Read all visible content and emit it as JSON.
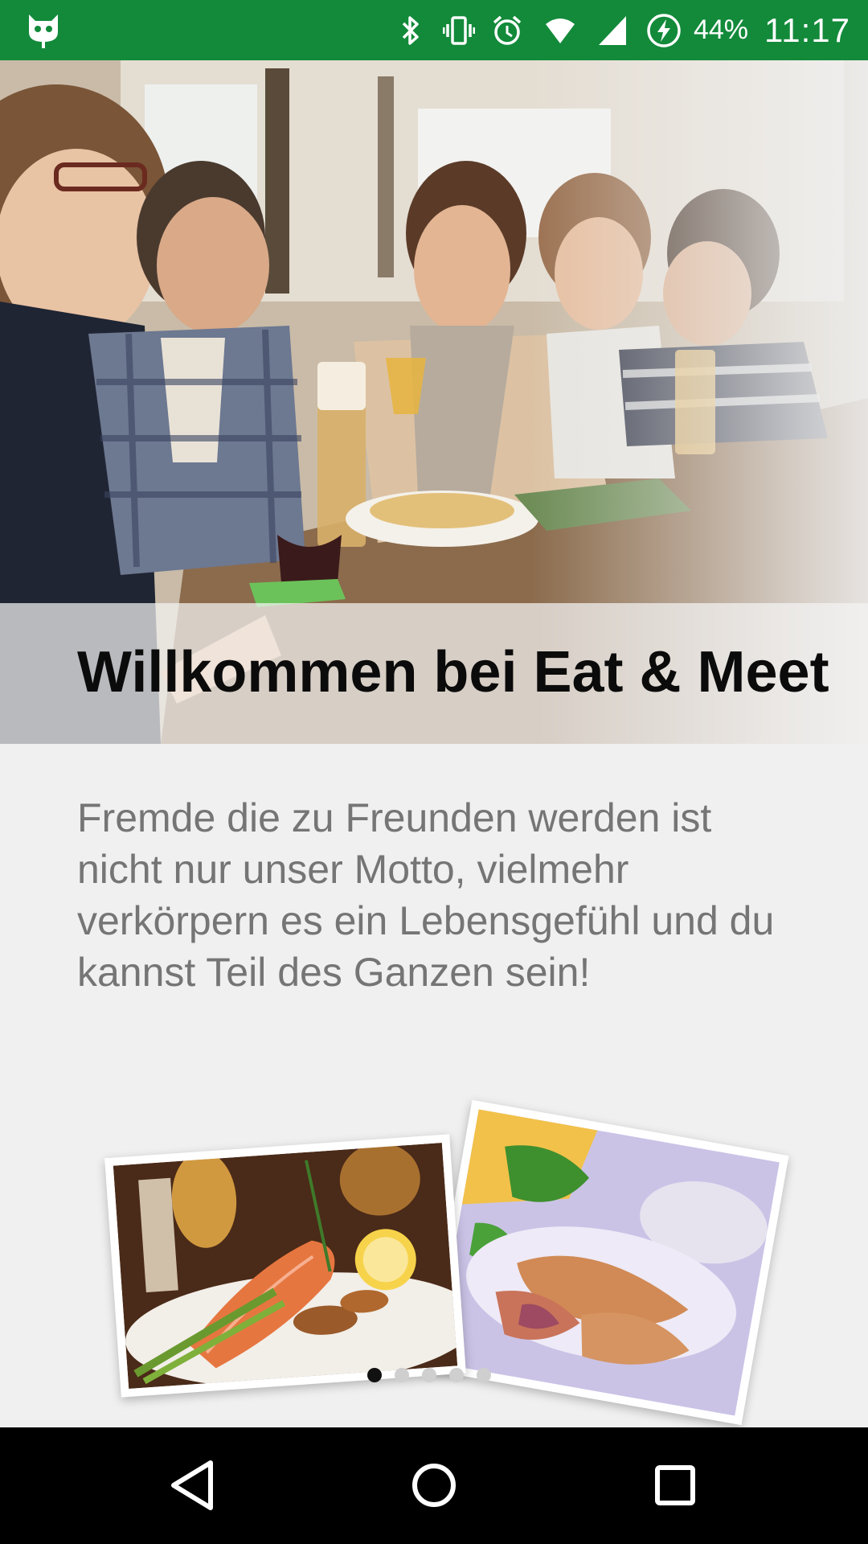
{
  "status_bar": {
    "left_icon": "cyanogen-mascot-icon",
    "icons": [
      "bluetooth-icon",
      "vibrate-icon",
      "alarm-icon",
      "wifi-icon",
      "cellular-signal-icon",
      "battery-charging-icon"
    ],
    "battery": "44%",
    "time": "11:17",
    "color": "#128a3a"
  },
  "hero": {
    "image": "people-dining-photo",
    "title": "Willkommen bei Eat & Meet"
  },
  "description": "Fremde die zu Freunden werden ist nicht nur unser Motto, vielmehr verkörpern es ein Lebensgefühl und du kannst Teil des Ganzen sein!",
  "photos": [
    {
      "name": "salmon-dish-photo"
    },
    {
      "name": "dumpling-dish-photo"
    }
  ],
  "pager": {
    "total": 5,
    "active_index": 0
  },
  "nav_bar": {
    "buttons": [
      "back-icon",
      "home-icon",
      "recents-icon"
    ]
  }
}
